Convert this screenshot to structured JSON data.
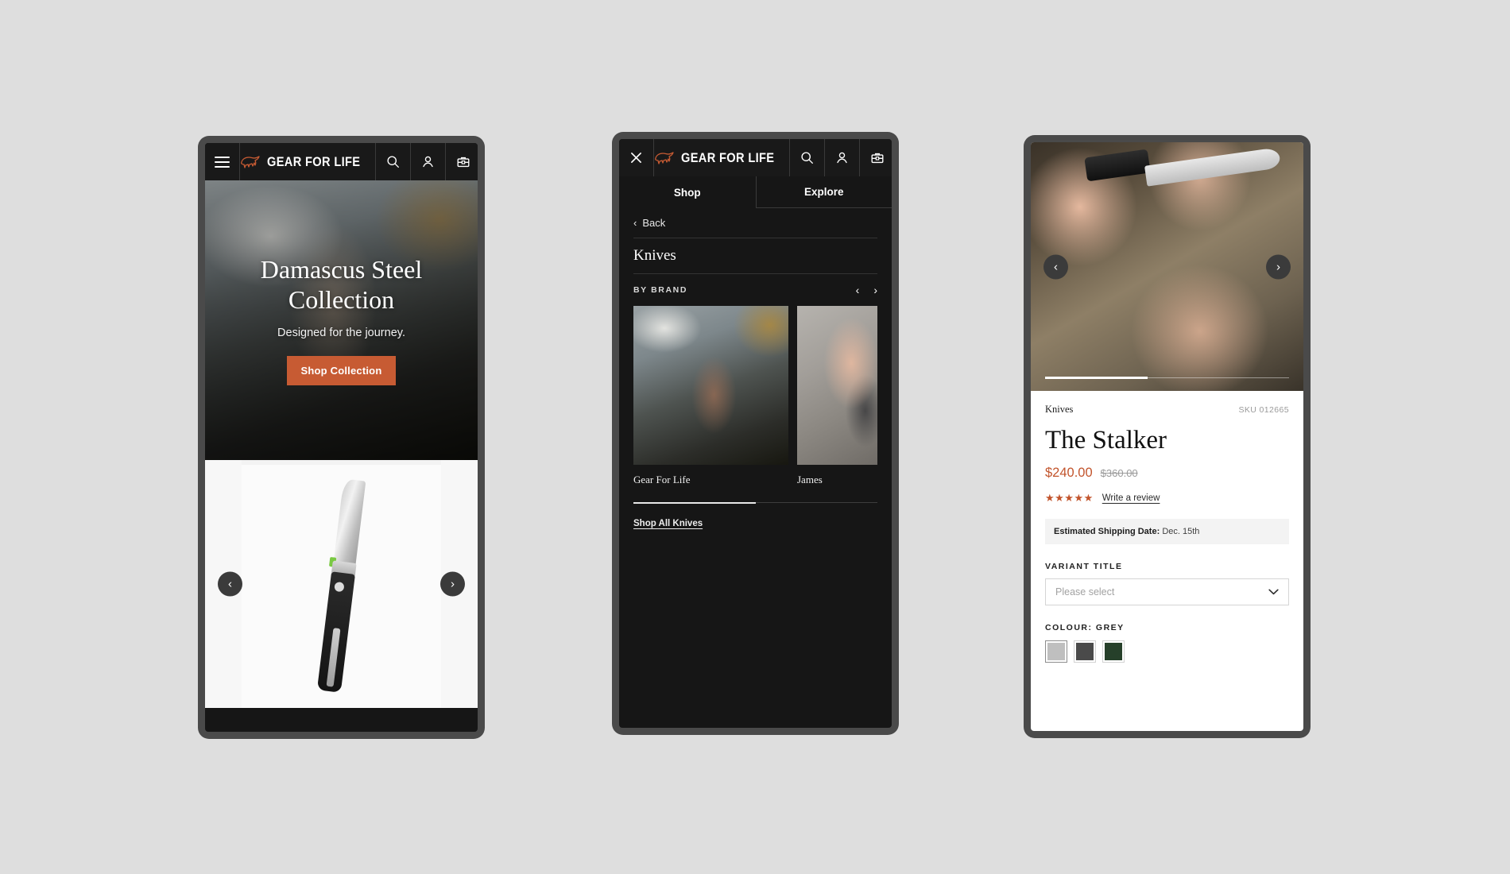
{
  "brand": {
    "name": "GEAR FOR LIFE",
    "logo_icon": "bison-icon",
    "accent_color": "#c75b33"
  },
  "nav": {
    "menu_icon": "hamburger-icon",
    "close_icon": "close-icon",
    "search_icon": "search-icon",
    "account_icon": "account-icon",
    "cart_icon": "toolbox-cart-icon"
  },
  "phone1": {
    "hero": {
      "title": "Damascus Steel Collection",
      "subtitle": "Designed for the journey.",
      "cta_label": "Shop Collection"
    },
    "carousel": {
      "prev_icon": "chevron-left-icon",
      "next_icon": "chevron-right-icon"
    }
  },
  "phone2": {
    "tabs": [
      {
        "label": "Shop",
        "active": true
      },
      {
        "label": "Explore",
        "active": false
      }
    ],
    "back_label": "Back",
    "back_icon": "chevron-left-icon",
    "category_heading": "Knives",
    "section_label": "BY BRAND",
    "carousel_prev_icon": "chevron-left-icon",
    "carousel_next_icon": "chevron-right-icon",
    "brands": [
      {
        "name": "Gear For Life"
      },
      {
        "name": "James"
      }
    ],
    "shop_all_label": "Shop All Knives"
  },
  "phone3": {
    "gallery": {
      "prev_icon": "chevron-left-icon",
      "next_icon": "chevron-right-icon"
    },
    "category": "Knives",
    "sku": "SKU 012665",
    "title": "The Stalker",
    "price_current": "$240.00",
    "price_compare": "$360.00",
    "stars": "★★★★★",
    "review_link": "Write a review",
    "shipping_label": "Estimated Shipping Date:",
    "shipping_value": "Dec. 15th",
    "variant_label": "VARIANT TITLE",
    "variant_placeholder": "Please select",
    "variant_chevron_icon": "chevron-down-icon",
    "colour_label": "COLOUR: GREY",
    "swatches": [
      {
        "name": "Grey",
        "hex": "#bfbfbf",
        "selected": true
      },
      {
        "name": "Charcoal",
        "hex": "#4a4a4a",
        "selected": false
      },
      {
        "name": "Forest Green",
        "hex": "#26402a",
        "selected": false
      }
    ]
  }
}
